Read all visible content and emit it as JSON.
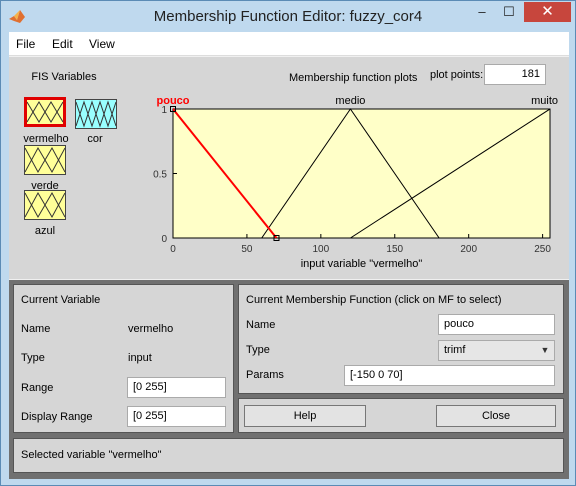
{
  "window": {
    "title": "Membership Function Editor: fuzzy_cor4",
    "controls": {
      "minimize": "–",
      "maximize": "☐",
      "close": "✕"
    }
  },
  "menu": [
    "File",
    "Edit",
    "View"
  ],
  "fis_variables": {
    "heading": "FIS Variables",
    "inputs": [
      {
        "name": "vermelho",
        "color": "#ffff99",
        "selected": true
      },
      {
        "name": "verde",
        "color": "#ffff99",
        "selected": false
      },
      {
        "name": "azul",
        "color": "#ffff99",
        "selected": false
      }
    ],
    "outputs": [
      {
        "name": "cor",
        "color": "#99ffff",
        "selected": false
      }
    ]
  },
  "plot": {
    "title": "Membership function plots",
    "plot_points_label": "plot points:",
    "plot_points": "181"
  },
  "chart_data": {
    "type": "line",
    "xlabel": "input variable \"vermelho\"",
    "ylabel": "",
    "xlim": [
      0,
      255
    ],
    "ylim": [
      0,
      1
    ],
    "xticks": [
      "0",
      "50",
      "100",
      "150",
      "200",
      "250"
    ],
    "yticks": [
      "0",
      "0.5",
      "1"
    ],
    "background": "#ffffc8",
    "series": [
      {
        "name": "pouco",
        "x": [
          -150,
          0,
          70
        ],
        "y": [
          0,
          1,
          0
        ],
        "color": "#ff0000",
        "selected": true
      },
      {
        "name": "medio",
        "x": [
          60,
          120,
          180
        ],
        "y": [
          0,
          1,
          0
        ],
        "color": "#000000",
        "selected": false
      },
      {
        "name": "muito",
        "x": [
          120,
          255,
          390
        ],
        "y": [
          0,
          1,
          0
        ],
        "color": "#000000",
        "selected": false
      }
    ]
  },
  "current_variable": {
    "heading": "Current Variable",
    "name_label": "Name",
    "name_value": "vermelho",
    "type_label": "Type",
    "type_value": "input",
    "range_label": "Range",
    "range_value": "[0 255]",
    "display_range_label": "Display Range",
    "display_range_value": "[0 255]"
  },
  "current_mf": {
    "heading": "Current Membership Function (click on MF to select)",
    "name_label": "Name",
    "name_value": "pouco",
    "type_label": "Type",
    "type_value": "trimf",
    "params_label": "Params",
    "params_value": "[-150 0 70]"
  },
  "buttons": {
    "help": "Help",
    "close": "Close"
  },
  "status": "Selected variable \"vermelho\""
}
